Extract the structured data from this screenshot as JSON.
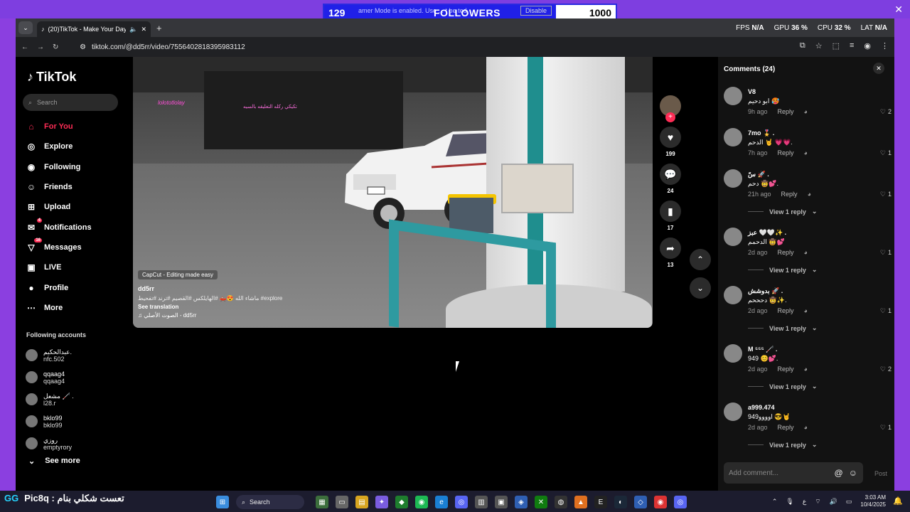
{
  "overlay": {
    "left_count": "129",
    "gamer_mode_text": "amer Mode is enabled. Use  ...  t be   ted.",
    "title": "FOLLOWERS",
    "disable_label": "Disable",
    "right_count": "1000",
    "close_glyph": "✕"
  },
  "browser": {
    "tab_title": "(20)TikTok - Make Your Day",
    "url": "tiktok.com/@dd5rr/video/7556402818395983112",
    "stats": [
      {
        "label": "FPS",
        "value": "N/A"
      },
      {
        "label": "GPU",
        "value": "36 %"
      },
      {
        "label": "CPU",
        "value": "32 %"
      },
      {
        "label": "LAT",
        "value": "N/A"
      }
    ]
  },
  "sidebar": {
    "logo": "TikTok",
    "search_placeholder": "Search",
    "nav": [
      {
        "label": "For You",
        "icon": "home-icon",
        "active": true
      },
      {
        "label": "Explore",
        "icon": "compass-icon"
      },
      {
        "label": "Following",
        "icon": "following-icon"
      },
      {
        "label": "Friends",
        "icon": "friends-icon"
      },
      {
        "label": "Upload",
        "icon": "upload-icon"
      },
      {
        "label": "Notifications",
        "icon": "notifications-icon",
        "badge": "4"
      },
      {
        "label": "Messages",
        "icon": "messages-icon",
        "badge": "16"
      },
      {
        "label": "LIVE",
        "icon": "live-icon"
      },
      {
        "label": "Profile",
        "icon": "profile-icon"
      },
      {
        "label": "More",
        "icon": "more-icon"
      }
    ],
    "following_title": "Following accounts",
    "following": [
      {
        "name": "عبدالحكيم.",
        "handle": "nfc.502"
      },
      {
        "name": "qqaag4",
        "handle": "qqaag4"
      },
      {
        "name": "مشعل 🦯 .",
        "handle": "l28.r"
      },
      {
        "name": "bklo99",
        "handle": "bklo99"
      },
      {
        "name": "روزي",
        "handle": "emptyrory"
      }
    ],
    "see_more": "See more"
  },
  "video": {
    "capcut": "CapCut - Editing made easy",
    "username": "dd5rr",
    "description": "ماشاء الله 😍🛻 #الهايلكس #القصيم #ترند #تفحيط #explore",
    "see_translation": "See translation",
    "music": "الصوت الأصلي - dd5rr",
    "neon1": "lolototlolay",
    "neon2": "تكيكي ركله التعليقه بالسيه"
  },
  "actions": {
    "likes": "199",
    "comments": "24",
    "saves": "17",
    "shares": "13"
  },
  "comments": {
    "title": "Comments (24)",
    "placeholder": "Add comment...",
    "post": "Post",
    "reply_label": "Reply",
    "view_reply": "View 1 reply",
    "items": [
      {
        "name": "V8",
        "text": "ابو دحيم 🥵",
        "time": "9h ago",
        "likes": "2",
        "has_reply": false
      },
      {
        "name": "7mo 🎖️ .",
        "text": "الدحم 🤘 💗💗.",
        "time": "7h ago",
        "likes": "1",
        "has_reply": false
      },
      {
        "name": "سّ 🚀 .",
        "text": "دحم 🤠💕.",
        "time": "21h ago",
        "likes": "1",
        "has_reply": true
      },
      {
        "name": "عبز 🤍🤍✨ .",
        "text": "الدحمم 🤠💕",
        "time": "2d ago",
        "likes": "1",
        "has_reply": true
      },
      {
        "name": "بدوشش 🚀 .",
        "text": "دحححم 🤠✨.",
        "time": "2d ago",
        "likes": "1",
        "has_reply": true
      },
      {
        "name": "M ⁵⁵⁵ 🦯 .",
        "text": "949 😊💕.",
        "time": "2d ago",
        "likes": "2",
        "has_reply": true
      },
      {
        "name": "a999.474",
        "text": "949اوووو 😎🤘",
        "time": "2d ago",
        "likes": "1",
        "has_reply": true
      }
    ]
  },
  "taskbar": {
    "left_tag": "GG",
    "left_text": "Pic8q : تعست شكلي بنام",
    "search": "Search",
    "clock_time": "3:03 AM",
    "clock_date": "10/4/2025",
    "lang": "ع"
  }
}
